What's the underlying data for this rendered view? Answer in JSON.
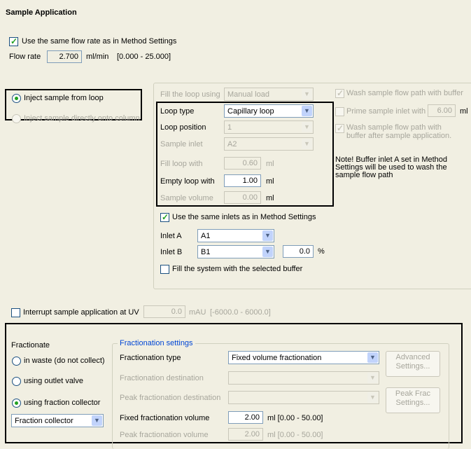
{
  "title": "Sample Application",
  "flow": {
    "same_rate_label": "Use the same flow rate as in Method Settings",
    "same_rate_checked": true,
    "rate_label": "Flow rate",
    "rate_value": "2.700",
    "rate_unit": "ml/min",
    "rate_range": "[0.000 - 25.000]"
  },
  "inject": {
    "from_loop_label": "Inject sample from loop",
    "direct_label": "Inject sample directly onto column"
  },
  "loop": {
    "fill_using_label": "Fill the loop using",
    "fill_using_value": "Manual load",
    "type_label": "Loop type",
    "type_value": "Capillary loop",
    "position_label": "Loop position",
    "position_value": "1",
    "inlet_label": "Sample inlet",
    "inlet_value": "A2",
    "fill_with_label": "Fill loop with",
    "fill_with_value": "0.60",
    "fill_with_unit": "ml",
    "empty_label": "Empty loop with",
    "empty_value": "1.00",
    "empty_unit": "ml",
    "volume_label": "Sample volume",
    "volume_value": "0.00",
    "volume_unit": "ml"
  },
  "options": {
    "wash_label": "Wash sample flow path with buffer",
    "prime_label": "Prime sample inlet with",
    "prime_value": "6.00",
    "prime_unit": "ml",
    "wash_after_label": "Wash sample flow path with\nbuffer after sample application.",
    "note": "Note! Buffer inlet A set in Method\nSettings will be used to wash the\nsample flow path"
  },
  "inlets": {
    "same_label": "Use the same inlets as in Method Settings",
    "a_label": "Inlet A",
    "a_value": "A1",
    "b_label": "Inlet B",
    "b_value": "B1",
    "percent_value": "0.0",
    "percent_unit": "%",
    "fill_system_label": "Fill the system with the selected buffer"
  },
  "interrupt": {
    "label": "Interrupt sample application at UV",
    "value": "0.0",
    "unit": "mAU",
    "range": "[-6000.0 - 6000.0]"
  },
  "fractionate": {
    "label": "Fractionate",
    "waste_label": "in waste (do not collect)",
    "outlet_label": "using outlet valve",
    "collector_label": "using fraction collector",
    "collector_value": "Fraction collector"
  },
  "frac_settings": {
    "legend": "Fractionation settings",
    "type_label": "Fractionation type",
    "type_value": "Fixed volume fractionation",
    "dest_label": "Fractionation destination",
    "peak_dest_label": "Peak fractionation destination",
    "fixed_vol_label": "Fixed fractionation volume",
    "fixed_vol_value": "2.00",
    "fixed_vol_unit": "ml [0.00 - 50.00]",
    "peak_vol_label": "Peak fractionation volume",
    "peak_vol_value": "2.00",
    "peak_vol_unit": "ml [0.00 - 50.00]",
    "advanced_button": "Advanced\nSettings...",
    "peak_frac_button": "Peak Frac\nSettings..."
  },
  "colors": {
    "accent": "#21a121",
    "background": "#f1efe2",
    "legend": "#0046d5"
  }
}
